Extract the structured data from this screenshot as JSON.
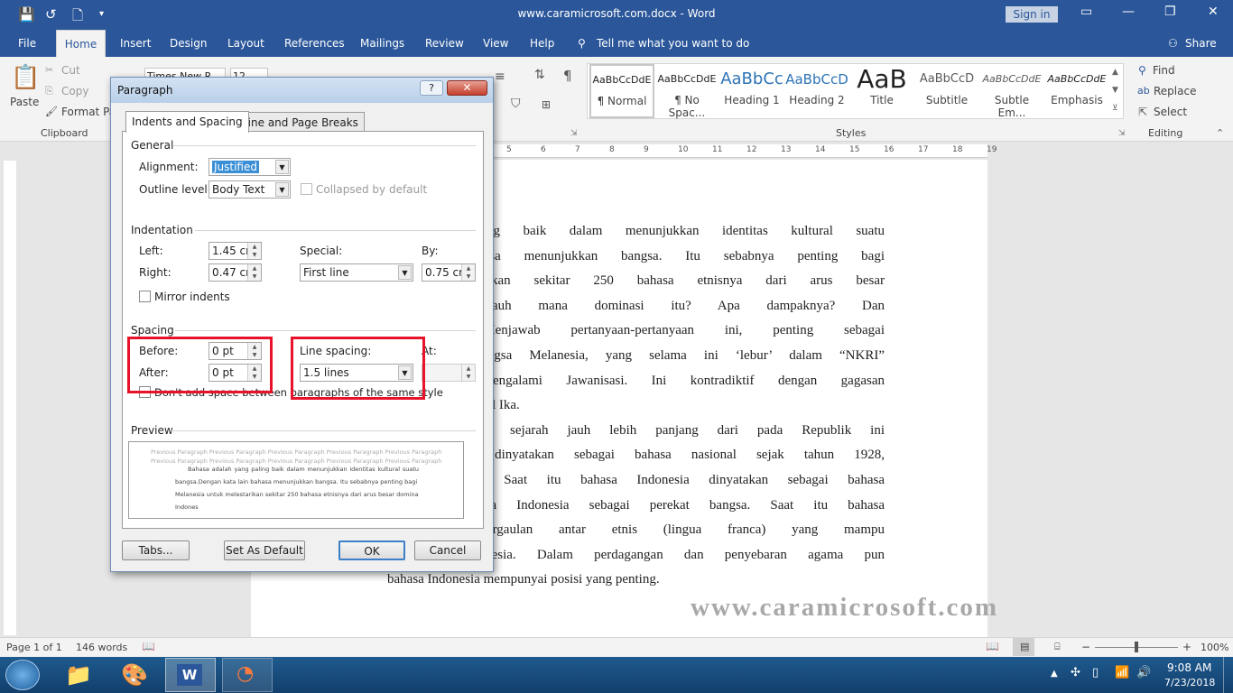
{
  "window": {
    "title": "www.caramicrosoft.com.docx - Word",
    "sign_in": "Sign in"
  },
  "ribbon_tabs": [
    "File",
    "Home",
    "Insert",
    "Design",
    "Layout",
    "References",
    "Mailings",
    "Review",
    "View",
    "Help"
  ],
  "tell_me": "Tell me what you want to do",
  "share": "Share",
  "clipboard": {
    "paste": "Paste",
    "cut": "Cut",
    "copy": "Copy",
    "format_painter": "Format Pa",
    "group": "Clipboard"
  },
  "font_name": "Times New R",
  "font_size": "12",
  "styles": {
    "group": "Styles",
    "items": [
      {
        "preview": "AaBbCcDdE",
        "name": "¶ Normal"
      },
      {
        "preview": "AaBbCcDdE",
        "name": "¶ No Spac..."
      },
      {
        "preview": "AaBbCc",
        "name": "Heading 1"
      },
      {
        "preview": "AaBbCcD",
        "name": "Heading 2"
      },
      {
        "preview": "AaB",
        "name": "Title"
      },
      {
        "preview": "AaBbCcD",
        "name": "Subtitle"
      },
      {
        "preview": "AaBbCcDdE",
        "name": "Subtle Em..."
      },
      {
        "preview": "AaBbCcDdE",
        "name": "Emphasis"
      }
    ]
  },
  "editing": {
    "find": "Find",
    "replace": "Replace",
    "select": "Select",
    "group": "Editing"
  },
  "ruler_numbers": [
    "5",
    "6",
    "7",
    "8",
    "9",
    "10",
    "11",
    "12",
    "13",
    "14",
    "15",
    "16",
    "17",
    "18",
    "19"
  ],
  "document": {
    "lines": [
      "n yang paling baik dalam menunjukkan identitas kultural suatu",
      "ta lain bahasa menunjukkan bangsa. Itu sebabnya penting bagi",
      "untuk melestarikan sekitar 250 bahasa etnisnya dari arus besar",
      "Indonesia’. Sejauh mana dominasi itu? Apa dampaknya? Dan",
      "historisnya? Menjawab pertanyaan-pertanyaan ini, penting sebagai",
      "n identitas bangsa Melanesia, yang selama ini ‘lebur’ dalam “NKRI”",
      "hal justru mengalami Jawanisasi. Ini kontradiktif dengan gagasan",
      "r-Bhinneka Tunggal Ika.",
      "esia mempunyai sejarah jauh lebih panjang dari pada Republik ini",
      "donesia telah dinyatakan sebagai bahasa nasional sejak tahun 1928,",
      "nesia merdeka. Saat itu bahasa Indonesia dinyatakan sebagai bahasa",
      "ggunakan bahasa Indonesia sebagai perekat bangsa. Saat itu bahasa",
      "i bahasa pergaulan antar etnis (lingua franca) yang mampu",
      "uku di Indonesia. Dalam perdagangan dan penyebaran agama pun",
      "bahasa Indonesia mempunyai posisi yang penting."
    ]
  },
  "watermark": "www.caramicrosoft.com",
  "status": {
    "page": "Page 1 of 1",
    "words": "146 words",
    "zoom": "100%",
    "zoom_level": 100
  },
  "taskbar": {
    "time": "9:08 AM",
    "date": "7/23/2018"
  },
  "dialog": {
    "title": "Paragraph",
    "help": "?",
    "close": "✕",
    "tabs": [
      "Indents and Spacing",
      "Line and Page Breaks"
    ],
    "general": {
      "heading": "General",
      "alignment_label": "Alignment:",
      "alignment": "Justified",
      "outline_label": "Outline level:",
      "outline": "Body Text",
      "collapsed": "Collapsed by default"
    },
    "indentation": {
      "heading": "Indentation",
      "left_label": "Left:",
      "left": "1.45 cm",
      "right_label": "Right:",
      "right": "0.47 cm",
      "special_label": "Special:",
      "special": "First line",
      "by_label": "By:",
      "by": "0.75 cm",
      "mirror": "Mirror indents"
    },
    "spacing": {
      "heading": "Spacing",
      "before_label": "Before:",
      "before": "0 pt",
      "after_label": "After:",
      "after": "0 pt",
      "line_spacing_label": "Line spacing:",
      "line_spacing": "1.5 lines",
      "at_label": "At:",
      "dont_add": "Don't add space between paragraphs of the same style"
    },
    "preview": {
      "heading": "Preview",
      "prev_line": "Previous Paragraph Previous Paragraph Previous Paragraph Previous Paragraph Previous Paragraph",
      "prev_line2": "Previous Paragraph Previous Paragraph Previous Paragraph Previous Paragraph Previous Paragraph",
      "sample": [
        "Bahasa adalah yang paling baik dalam menunjukkan identitas kultural suatu",
        "bangsa.Dengan kata lain bahasa menunjukkan bangsa. Itu sebabnya penting bagi bangsa",
        "Melanesia untuk melestarikan sekitar 250 bahasa etnisnya dari arus besar dominasi “bahasa",
        "Indones"
      ]
    },
    "buttons": {
      "tabs": "Tabs...",
      "set_default": "Set As Default",
      "ok": "OK",
      "cancel": "Cancel"
    }
  }
}
